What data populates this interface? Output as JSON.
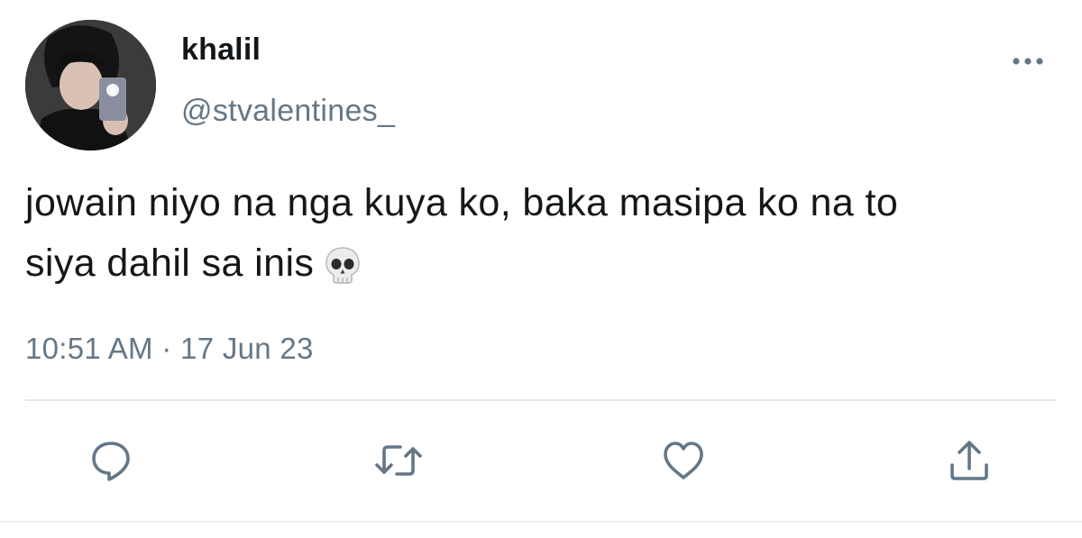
{
  "tweet": {
    "display_name": "khalil",
    "handle": "@stvalentines_",
    "text_line1": "jowain niyo na nga kuya ko, baka masipa ko na to",
    "text_line2": "siya dahil sa inis",
    "emoji": "skull-emoji",
    "timestamp": "10:51 AM · 17 Jun 23"
  },
  "actions": [
    {
      "icon": "reply-icon"
    },
    {
      "icon": "retweet-icon"
    },
    {
      "icon": "like-icon"
    },
    {
      "icon": "share-icon"
    }
  ],
  "colors": {
    "text": "#14171a",
    "secondary": "#657786",
    "icon": "#657786",
    "divider": "#e1e8ed",
    "background": "#ffffff"
  }
}
